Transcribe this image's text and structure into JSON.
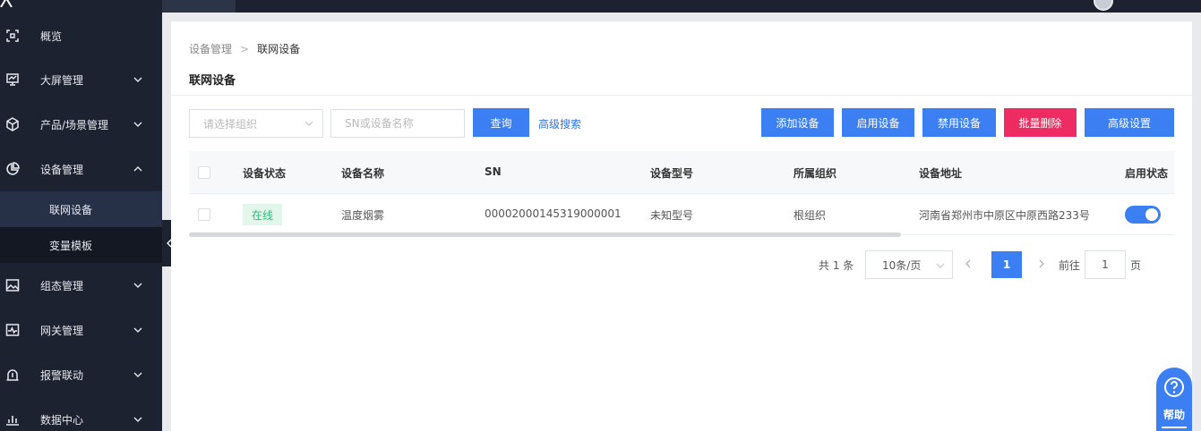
{
  "sidebar": {
    "items": [
      {
        "label": "概览",
        "icon": "overview-icon"
      },
      {
        "label": "大屏管理",
        "icon": "monitor-icon"
      },
      {
        "label": "产品/场景管理",
        "icon": "cube-icon"
      },
      {
        "label": "设备管理",
        "icon": "pie-chart-icon"
      },
      {
        "label": "组态管理",
        "icon": "image-icon"
      },
      {
        "label": "网关管理",
        "icon": "pulse-icon"
      },
      {
        "label": "报警联动",
        "icon": "alarm-icon"
      },
      {
        "label": "数据中心",
        "icon": "bar-chart-icon"
      }
    ],
    "sub_items": [
      {
        "label": "联网设备"
      },
      {
        "label": "变量模板"
      }
    ]
  },
  "breadcrumb": {
    "parent": "设备管理",
    "current": "联网设备"
  },
  "page_title": "联网设备",
  "filters": {
    "org_placeholder": "请选择组织",
    "search_placeholder": "SN或设备名称",
    "query_label": "查询",
    "advanced_search_label": "高级搜索"
  },
  "actions": {
    "add": "添加设备",
    "enable": "启用设备",
    "disable": "禁用设备",
    "batch_delete": "批量删除",
    "advanced_settings": "高级设置"
  },
  "table": {
    "headers": [
      "设备状态",
      "设备名称",
      "SN",
      "设备型号",
      "所属组织",
      "设备地址",
      "启用状态"
    ],
    "rows": [
      {
        "status": "在线",
        "name": "温度烟雾",
        "sn": "00002000145319000001",
        "model": "未知型号",
        "org": "根组织",
        "address": "河南省郑州市中原区中原西路233号",
        "enabled": true
      }
    ]
  },
  "pagination": {
    "total": "共 1 条",
    "page_size": "10条/页",
    "current_page": "1",
    "goto_label": "前往",
    "goto_value": "1",
    "page_suffix": "页"
  },
  "help": {
    "label": "帮助"
  },
  "colors": {
    "primary": "#3b7ff2",
    "danger": "#ee2b62",
    "sidebar": "#1d2230",
    "online": "#2dbb7a"
  }
}
